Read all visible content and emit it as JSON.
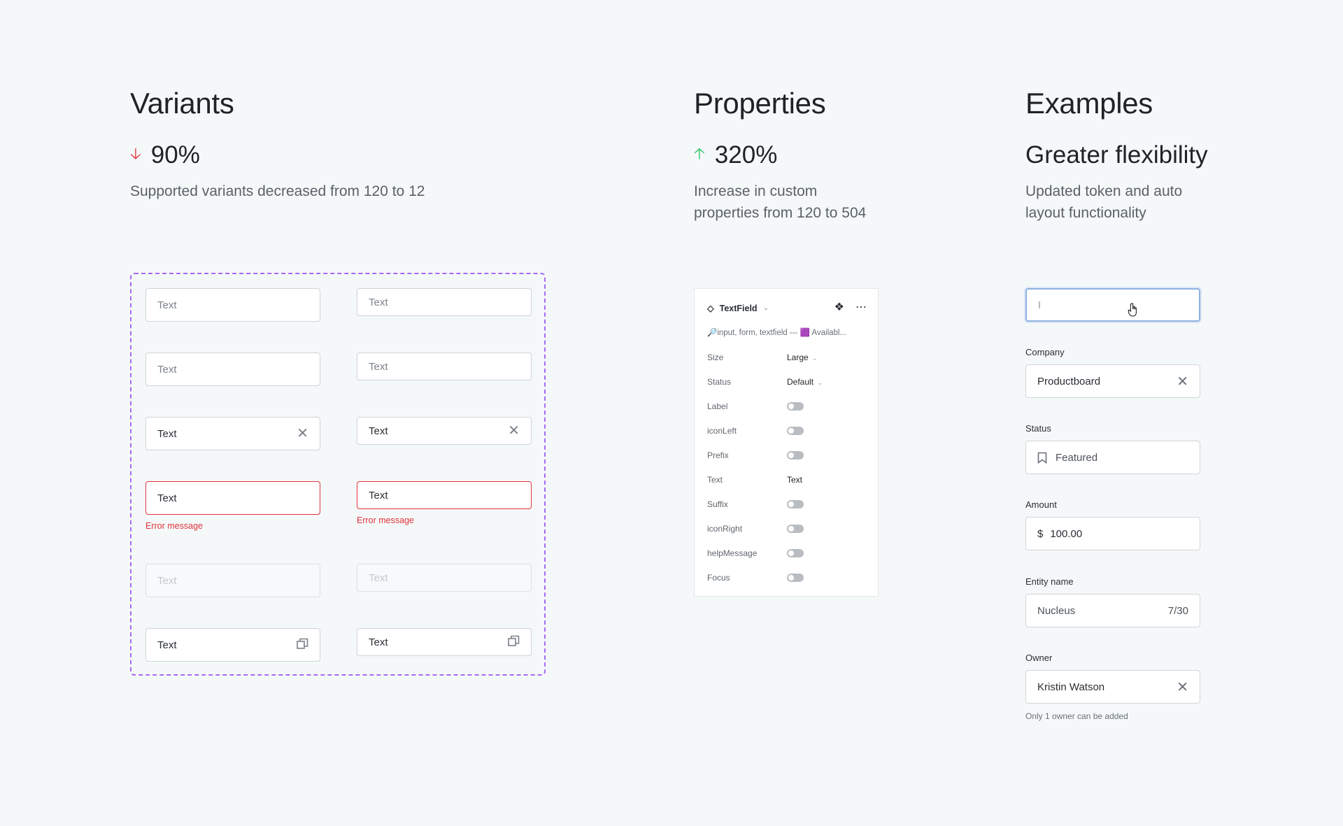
{
  "columns": {
    "variants": {
      "title": "Variants",
      "stat_value": "90%",
      "stat_arrow": "down-arrow-icon",
      "stat_color": "#e0343a",
      "description": "Supported variants decreased from 120 to 12"
    },
    "properties": {
      "title": "Properties",
      "stat_value": "320%",
      "stat_arrow": "up-arrow-icon",
      "stat_color": "#22c55e",
      "description_line1": "Increase in custom",
      "description_line2": "properties from 120 to 504"
    },
    "examples": {
      "title": "Examples",
      "subtitle": "Greater flexibility",
      "description_line1": "Updated token and auto",
      "description_line2": "layout functionality"
    }
  },
  "variants": {
    "field_text": "Text",
    "error_message": "Error message"
  },
  "panel": {
    "component_name": "TextField",
    "tags": "🔎input, form, textfield --- 🟪 Availabl...",
    "props": [
      {
        "label": "Size",
        "value": "Large"
      },
      {
        "label": "Status",
        "value": "Default"
      },
      {
        "label": "Label"
      },
      {
        "label": "iconLeft"
      },
      {
        "label": "Prefix"
      },
      {
        "label": "Text",
        "value": "Text"
      },
      {
        "label": "Suffix"
      },
      {
        "label": "iconRight"
      },
      {
        "label": "helpMessage"
      },
      {
        "label": "Focus"
      }
    ]
  },
  "examples": {
    "focused_value": "I",
    "company_label": "Company",
    "company_value": "Productboard",
    "status_label": "Status",
    "status_value": "Featured",
    "amount_label": "Amount",
    "amount_prefix": "$",
    "amount_value": "100.00",
    "entity_label": "Entity name",
    "entity_value": "Nucleus",
    "entity_count": "7/30",
    "owner_label": "Owner",
    "owner_value": "Kristin Watson",
    "owner_help": "Only 1 owner can be added"
  }
}
